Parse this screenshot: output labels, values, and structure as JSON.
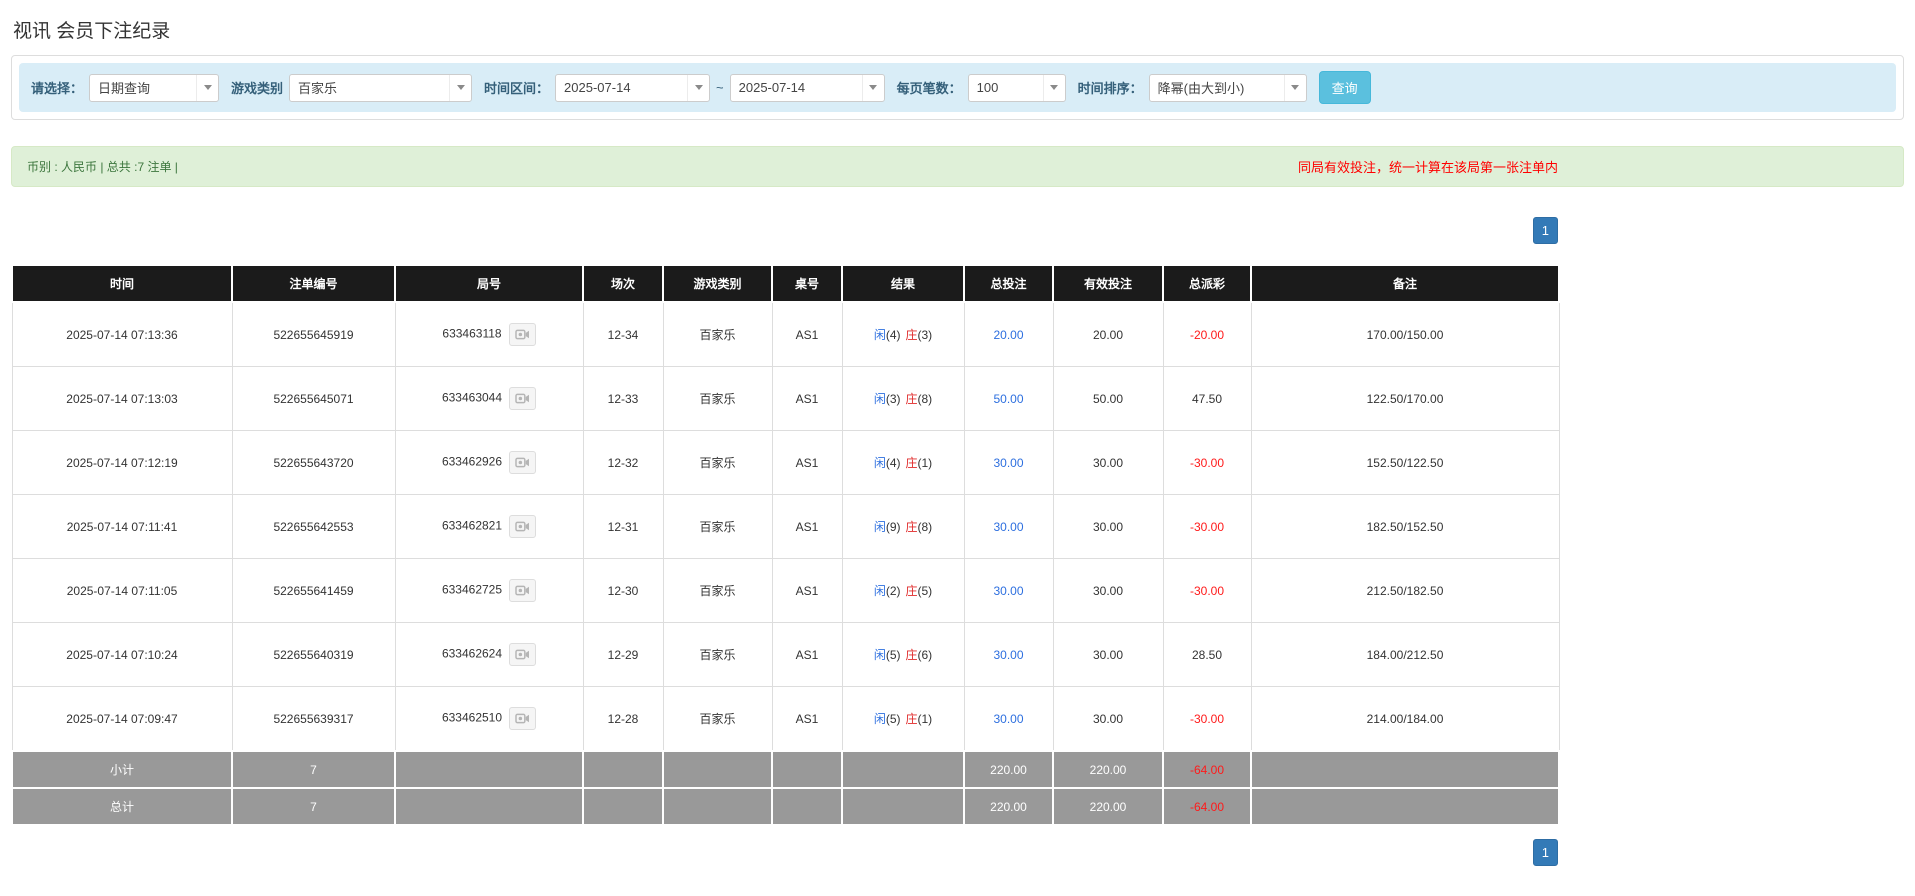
{
  "page_title": "视讯 会员下注纪录",
  "filters": {
    "select_label": "请选择：",
    "select_value": "日期查询",
    "game_type_label": "游戏类别",
    "game_type_value": "百家乐",
    "date_range_label": "时间区间：",
    "date_from": "2025-07-14",
    "date_separator": "~",
    "date_to": "2025-07-14",
    "page_size_label": "每页笔数：",
    "page_size_value": "100",
    "sort_label": "时间排序：",
    "sort_value": "降幂(由大到小)",
    "search_button": "查询"
  },
  "summary": {
    "left_text": "币别 : 人民币 | 总共 :7 注单 |",
    "right_note": "同局有效投注，统一计算在该局第一张注单内"
  },
  "pagination": {
    "page": "1"
  },
  "icons": {
    "dropdown_caret": "chevron-down-icon",
    "round_video": "film-icon"
  },
  "colors": {
    "filter_bar_bg": "#d9edf7",
    "filter_label": "#35607a",
    "search_button_bg": "#5bc0de",
    "summary_bg": "#dff0d8",
    "summary_text": "#3c763d",
    "note_red": "#ff0000",
    "header_bg": "#1b1b1b",
    "footer_bg": "#999999",
    "player_blue": "#2d6fdf",
    "banker_red": "#e02b2b",
    "negative_red": "#ff1a1a",
    "pagination_bg": "#337ab7"
  },
  "table": {
    "headers": [
      "时间",
      "注单编号",
      "局号",
      "场次",
      "游戏类别",
      "桌号",
      "结果",
      "总投注",
      "有效投注",
      "总派彩",
      "备注"
    ],
    "rows": [
      {
        "time": "2025-07-14 07:13:36",
        "bet_id": "522655645919",
        "round_id": "633463118",
        "session": "12-34",
        "game": "百家乐",
        "table_no": "AS1",
        "result_player": "闲",
        "result_player_score": "(4)",
        "result_banker": "庄",
        "result_banker_score": "(3)",
        "total_bet": "20.00",
        "valid_bet": "20.00",
        "payout": "-20.00",
        "remark": "170.00/150.00"
      },
      {
        "time": "2025-07-14 07:13:03",
        "bet_id": "522655645071",
        "round_id": "633463044",
        "session": "12-33",
        "game": "百家乐",
        "table_no": "AS1",
        "result_player": "闲",
        "result_player_score": "(3)",
        "result_banker": "庄",
        "result_banker_score": "(8)",
        "total_bet": "50.00",
        "valid_bet": "50.00",
        "payout": "47.50",
        "remark": "122.50/170.00"
      },
      {
        "time": "2025-07-14 07:12:19",
        "bet_id": "522655643720",
        "round_id": "633462926",
        "session": "12-32",
        "game": "百家乐",
        "table_no": "AS1",
        "result_player": "闲",
        "result_player_score": "(4)",
        "result_banker": "庄",
        "result_banker_score": "(1)",
        "total_bet": "30.00",
        "valid_bet": "30.00",
        "payout": "-30.00",
        "remark": "152.50/122.50"
      },
      {
        "time": "2025-07-14 07:11:41",
        "bet_id": "522655642553",
        "round_id": "633462821",
        "session": "12-31",
        "game": "百家乐",
        "table_no": "AS1",
        "result_player": "闲",
        "result_player_score": "(9)",
        "result_banker": "庄",
        "result_banker_score": "(8)",
        "total_bet": "30.00",
        "valid_bet": "30.00",
        "payout": "-30.00",
        "remark": "182.50/152.50"
      },
      {
        "time": "2025-07-14 07:11:05",
        "bet_id": "522655641459",
        "round_id": "633462725",
        "session": "12-30",
        "game": "百家乐",
        "table_no": "AS1",
        "result_player": "闲",
        "result_player_score": "(2)",
        "result_banker": "庄",
        "result_banker_score": "(5)",
        "total_bet": "30.00",
        "valid_bet": "30.00",
        "payout": "-30.00",
        "remark": "212.50/182.50"
      },
      {
        "time": "2025-07-14 07:10:24",
        "bet_id": "522655640319",
        "round_id": "633462624",
        "session": "12-29",
        "game": "百家乐",
        "table_no": "AS1",
        "result_player": "闲",
        "result_player_score": "(5)",
        "result_banker": "庄",
        "result_banker_score": "(6)",
        "total_bet": "30.00",
        "valid_bet": "30.00",
        "payout": "28.50",
        "remark": "184.00/212.50"
      },
      {
        "time": "2025-07-14 07:09:47",
        "bet_id": "522655639317",
        "round_id": "633462510",
        "session": "12-28",
        "game": "百家乐",
        "table_no": "AS1",
        "result_player": "闲",
        "result_player_score": "(5)",
        "result_banker": "庄",
        "result_banker_score": "(1)",
        "total_bet": "30.00",
        "valid_bet": "30.00",
        "payout": "-30.00",
        "remark": "214.00/184.00"
      }
    ],
    "subtotal": {
      "label": "小计",
      "count": "7",
      "total_bet": "220.00",
      "valid_bet": "220.00",
      "payout": "-64.00"
    },
    "total": {
      "label": "总计",
      "count": "7",
      "total_bet": "220.00",
      "valid_bet": "220.00",
      "payout": "-64.00"
    }
  }
}
